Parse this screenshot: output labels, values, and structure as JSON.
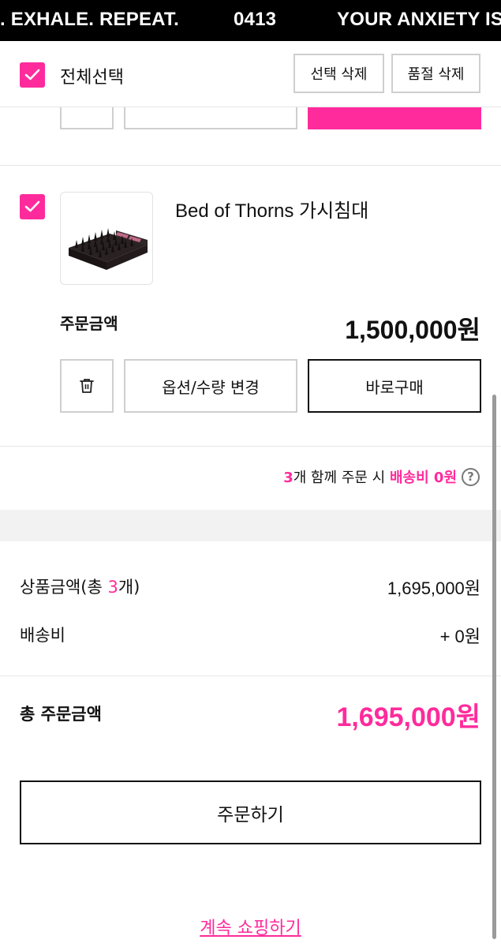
{
  "banner": {
    "texts": [
      ". EXHALE. REPEAT.",
      "0413",
      "YOUR ANXIETY IS"
    ]
  },
  "select_bar": {
    "select_all_label": "전체선택",
    "delete_selected_label": "선택 삭제",
    "delete_soldout_label": "품절 삭제",
    "checked": true
  },
  "item": {
    "checked": true,
    "name": "Bed of Thorns 가시침대",
    "order_amount_label": "주문금액",
    "order_amount_value": "1,500,000원",
    "option_change_label": "옵션/수량 변경",
    "buy_now_label": "바로구매",
    "icons": [
      "check-icon",
      "trash-icon"
    ]
  },
  "shipping_notice": {
    "count": "3",
    "text_middle": "개 함께 주문 시 ",
    "highlight": "배송비 0원",
    "help_icon": "?"
  },
  "summary": {
    "product_amount_prefix": "상품금액(총 ",
    "product_count": "3",
    "product_amount_suffix": "개)",
    "product_amount_value": "1,695,000원",
    "shipping_label": "배송비",
    "shipping_value": "+ 0원",
    "total_label": "총 주문금액",
    "total_value": "1,695,000원"
  },
  "actions": {
    "order_label": "주문하기",
    "continue_shopping_label": "계속 쇼핑하기"
  },
  "colors": {
    "accent": "#ff2b9c",
    "banner_bg": "#000000",
    "border": "#cfcfcf"
  }
}
